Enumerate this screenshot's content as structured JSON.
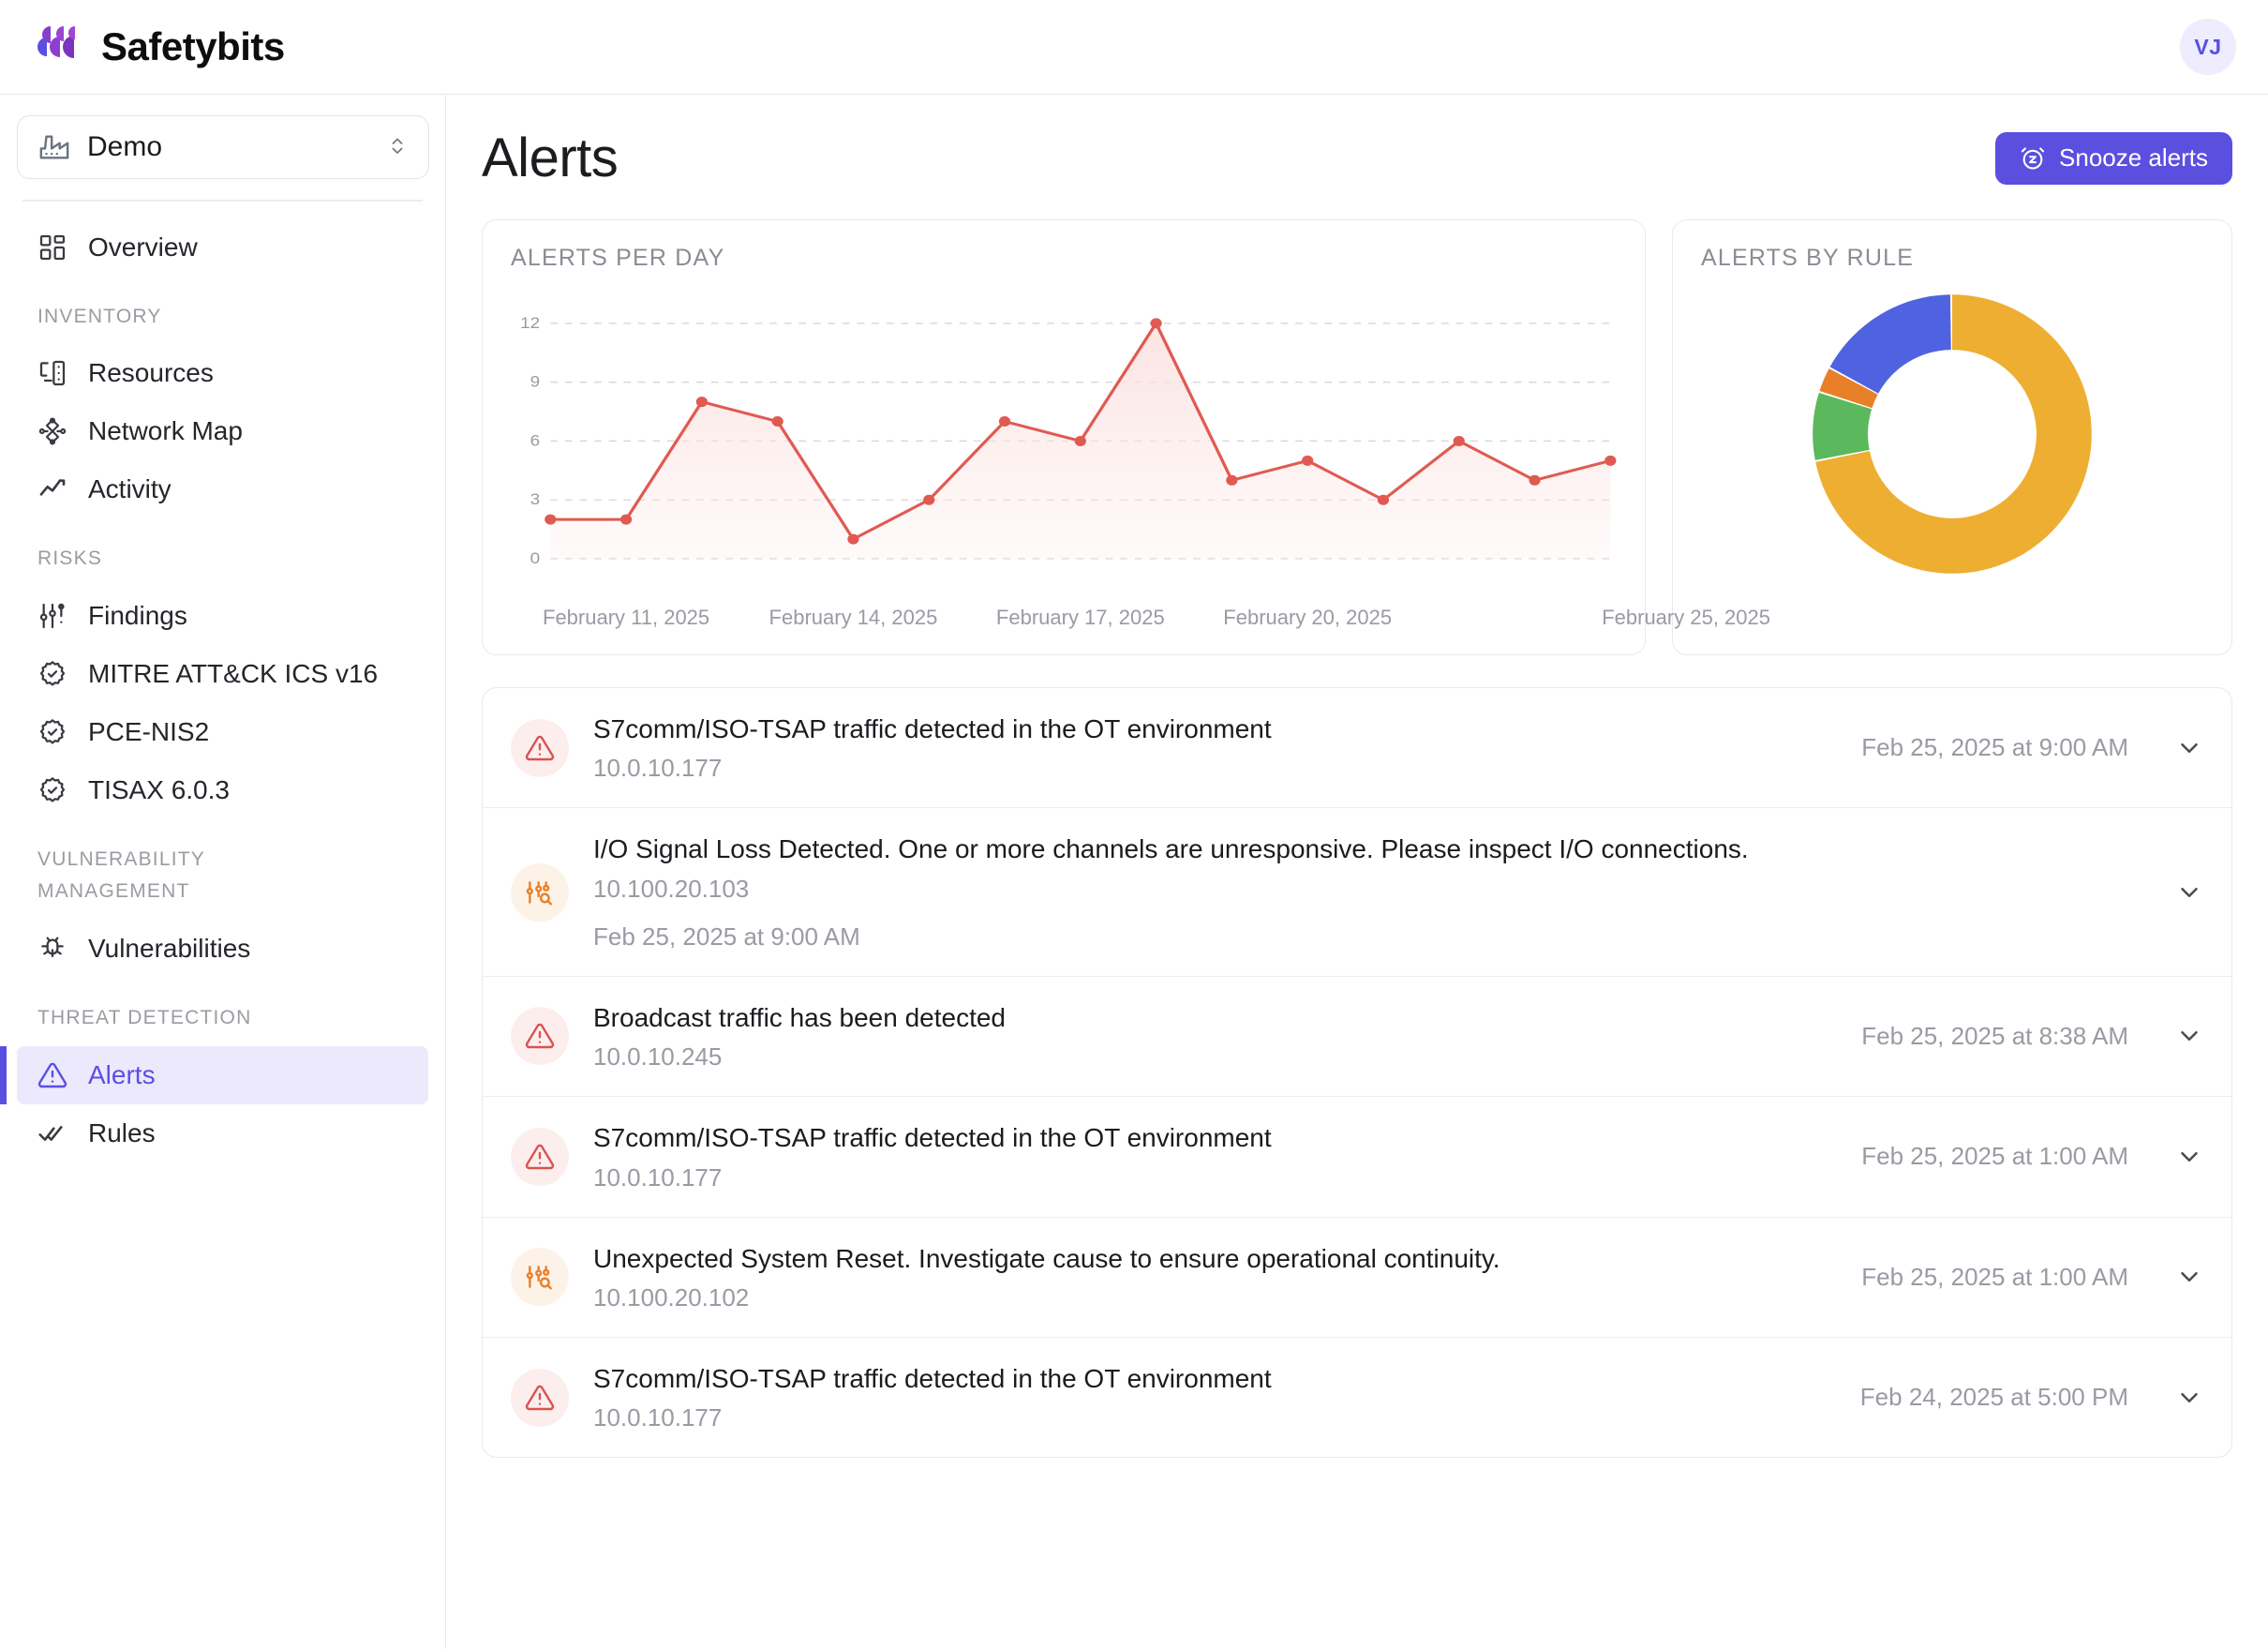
{
  "brand": {
    "name": "Safetybits",
    "logo_icon": "safetybits-logo"
  },
  "user": {
    "initials": "VJ"
  },
  "org_selector": {
    "icon": "factory-icon",
    "value": "Demo",
    "caret_icon": "chevron-up-down-icon"
  },
  "sidebar": {
    "groups": [
      {
        "label": "",
        "items": [
          {
            "label": "Overview",
            "icon": "layout-dashboard-icon",
            "active": false
          }
        ]
      },
      {
        "label": "INVENTORY",
        "items": [
          {
            "label": "Resources",
            "icon": "server-icon",
            "active": false
          },
          {
            "label": "Network Map",
            "icon": "network-map-icon",
            "active": false
          },
          {
            "label": "Activity",
            "icon": "activity-line-icon",
            "active": false
          }
        ]
      },
      {
        "label": "RISKS",
        "items": [
          {
            "label": "Findings",
            "icon": "sliders-alert-icon",
            "active": false
          },
          {
            "label": "MITRE ATT&CK ICS v16",
            "icon": "badge-check-icon",
            "active": false
          },
          {
            "label": "PCE-NIS2",
            "icon": "badge-check-icon",
            "active": false
          },
          {
            "label": "TISAX 6.0.3",
            "icon": "badge-check-icon",
            "active": false
          }
        ]
      },
      {
        "label": "VULNERABILITY MANAGEMENT",
        "items": [
          {
            "label": "Vulnerabilities",
            "icon": "bug-icon",
            "active": false
          }
        ]
      },
      {
        "label": "THREAT DETECTION",
        "items": [
          {
            "label": "Alerts",
            "icon": "triangle-alert-icon",
            "active": true
          },
          {
            "label": "Rules",
            "icon": "double-check-icon",
            "active": false
          }
        ]
      }
    ]
  },
  "header": {
    "title": "Alerts",
    "snooze_label": "Snooze alerts",
    "snooze_icon": "alarm-snooze-icon",
    "accent_color": "#5b4fe0"
  },
  "chart_data": [
    {
      "type": "line",
      "title": "ALERTS PER DAY",
      "xlabel": "",
      "ylabel": "",
      "ylim": [
        0,
        13
      ],
      "yticks": [
        0,
        3,
        6,
        9,
        12
      ],
      "grid": true,
      "legend": "none",
      "line_color": "#e05a52",
      "fill_color": "#fbe3e1",
      "x": [
        "February 10, 2025",
        "February 11, 2025",
        "February 12, 2025",
        "February 13, 2025",
        "February 14, 2025",
        "February 15, 2025",
        "February 16, 2025",
        "February 17, 2025",
        "February 18, 2025",
        "February 19, 2025",
        "February 20, 2025",
        "February 21, 2025",
        "February 22, 2025",
        "February 23, 2025",
        "February 24, 2025",
        "February 25, 2025"
      ],
      "values": [
        2,
        2,
        8,
        7,
        1,
        3,
        7,
        6,
        12,
        4,
        5,
        3,
        6,
        4,
        5
      ],
      "xtick_labels": [
        "February 11, 2025",
        "February 14, 2025",
        "February 17, 2025",
        "February 20, 2025",
        "February 25, 2025"
      ]
    },
    {
      "type": "pie",
      "title": "ALERTS BY RULE",
      "donut": true,
      "legend": "none",
      "slices": [
        {
          "label": "segment-1",
          "value": 72,
          "color": "#eeae32"
        },
        {
          "label": "segment-2",
          "value": 8,
          "color": "#5cb85c"
        },
        {
          "label": "segment-3",
          "value": 3,
          "color": "#e8802a"
        },
        {
          "label": "segment-4",
          "value": 17,
          "color": "#4f63e0"
        }
      ]
    }
  ],
  "alerts": [
    {
      "icon": "triangle-alert-icon",
      "severity": "red",
      "title": "S7comm/ISO-TSAP traffic detected in the OT environment",
      "ip": "10.0.10.177",
      "time": "Feb 25, 2025 at 9:00 AM",
      "wrapped": false
    },
    {
      "icon": "sliders-search-icon",
      "severity": "orange",
      "title": "I/O Signal Loss Detected. One or more channels are unresponsive. Please inspect I/O connections.",
      "ip": "10.100.20.103",
      "time": "Feb 25, 2025 at 9:00 AM",
      "wrapped": true
    },
    {
      "icon": "triangle-alert-icon",
      "severity": "red",
      "title": "Broadcast traffic has been detected",
      "ip": "10.0.10.245",
      "time": "Feb 25, 2025 at 8:38 AM",
      "wrapped": false
    },
    {
      "icon": "triangle-alert-icon",
      "severity": "red",
      "title": "S7comm/ISO-TSAP traffic detected in the OT environment",
      "ip": "10.0.10.177",
      "time": "Feb 25, 2025 at 1:00 AM",
      "wrapped": false
    },
    {
      "icon": "sliders-search-icon",
      "severity": "orange",
      "title": "Unexpected System Reset. Investigate cause to ensure operational continuity.",
      "ip": "10.100.20.102",
      "time": "Feb 25, 2025 at 1:00 AM",
      "wrapped": false
    },
    {
      "icon": "triangle-alert-icon",
      "severity": "red",
      "title": "S7comm/ISO-TSAP traffic detected in the OT environment",
      "ip": "10.0.10.177",
      "time": "Feb 24, 2025 at 5:00 PM",
      "wrapped": false
    }
  ]
}
